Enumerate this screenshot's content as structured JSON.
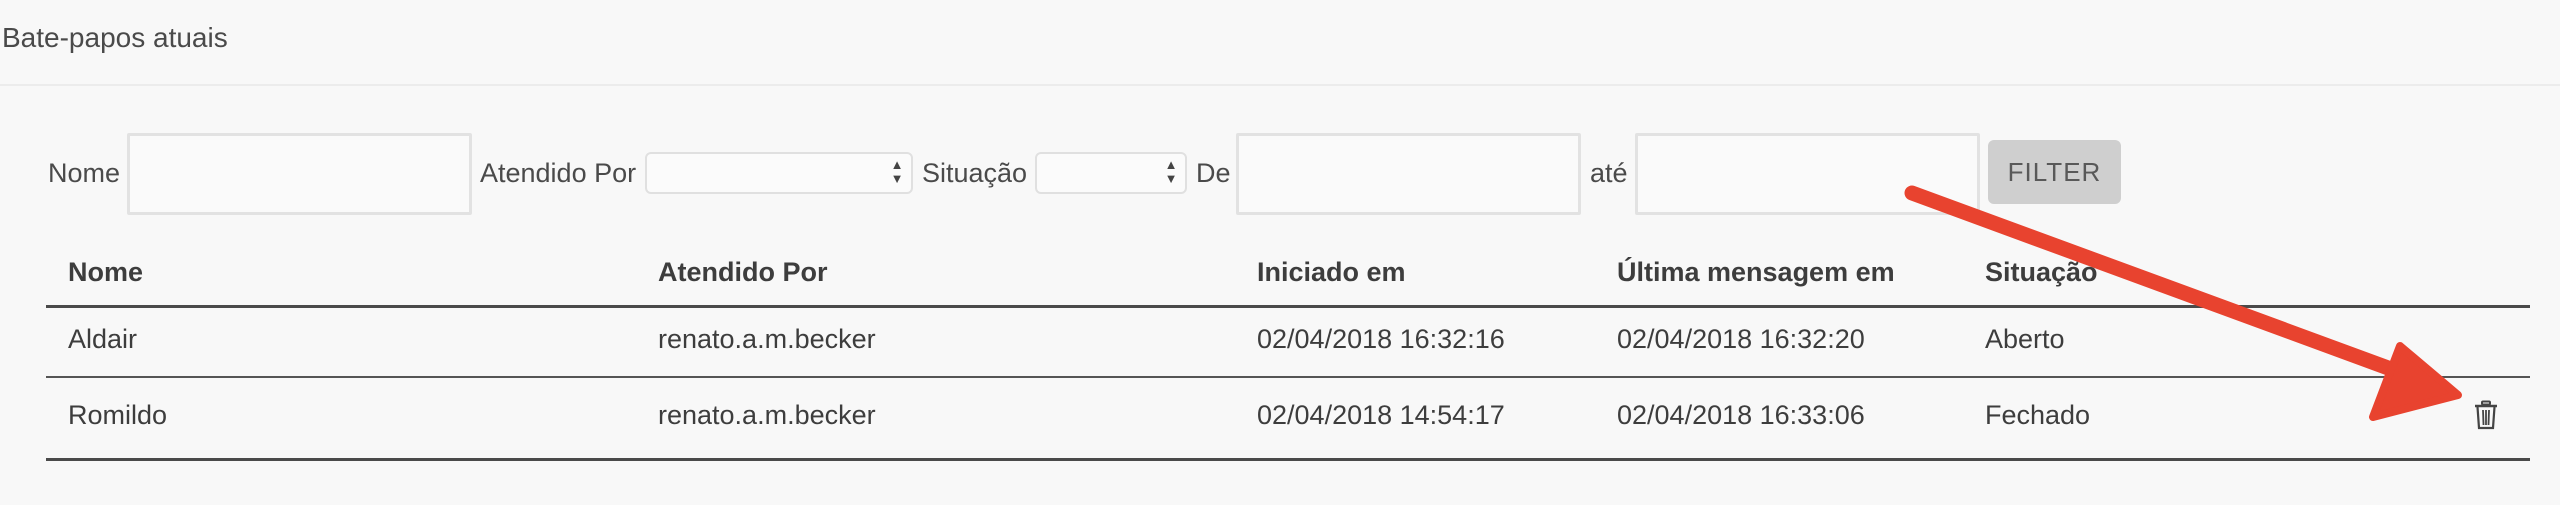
{
  "header": {
    "title": "Bate-papos atuais"
  },
  "filters": {
    "nome_label": "Nome",
    "nome_value": "",
    "atendido_label": "Atendido Por",
    "atendido_value": "",
    "situacao_label": "Situação",
    "situacao_value": "",
    "de_label": "De",
    "de_value": "",
    "ate_label": "até",
    "ate_value": "",
    "filter_button": "FILTER"
  },
  "table": {
    "columns": [
      "Nome",
      "Atendido Por",
      "Iniciado em",
      "Última mensagem em",
      "Situação"
    ],
    "rows": [
      {
        "nome": "Aldair",
        "atendido": "renato.a.m.becker",
        "iniciado": "02/04/2018 16:32:16",
        "ultima": "02/04/2018 16:32:20",
        "situacao": "Aberto",
        "delete_icon": false
      },
      {
        "nome": "Romildo",
        "atendido": "renato.a.m.becker",
        "iniciado": "02/04/2018 14:54:17",
        "ultima": "02/04/2018 16:33:06",
        "situacao": "Fechado",
        "delete_icon": true
      }
    ]
  },
  "icons": {
    "delete": "trash-icon",
    "select": "select-arrows-icon"
  },
  "colors": {
    "annotation_arrow": "#e8432f",
    "button_bg": "#cfcfcf",
    "background": "#f8f8f8"
  }
}
